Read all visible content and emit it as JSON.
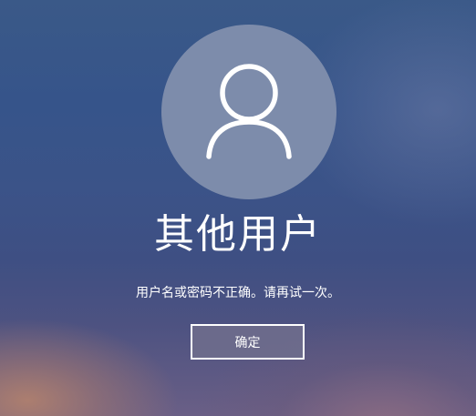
{
  "login": {
    "username": "其他用户",
    "error_message": "用户名或密码不正确。请再试一次。",
    "ok_button_label": "确定"
  },
  "icons": {
    "avatar": "user-silhouette-icon"
  },
  "colors": {
    "avatar_circle": "#7d8cab",
    "button_fill": "#6e6c8c",
    "button_border": "#ffffff",
    "text": "#ffffff"
  }
}
